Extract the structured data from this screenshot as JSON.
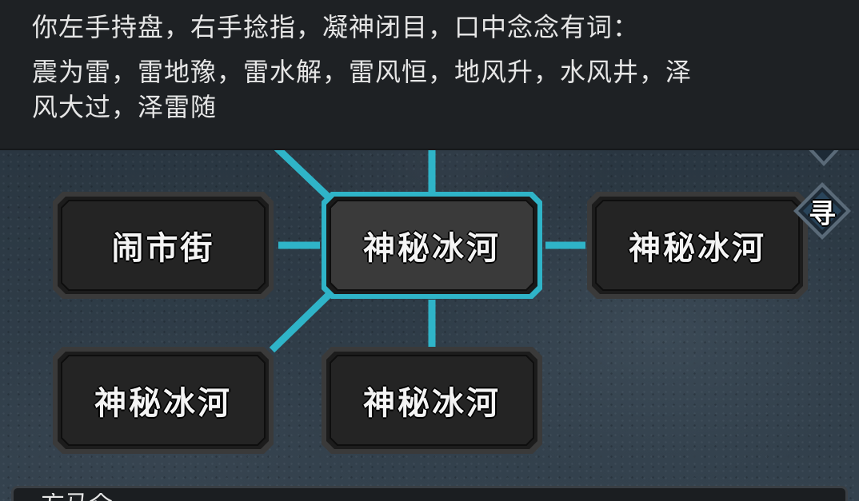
{
  "narration": {
    "lines": [
      "你左手持盘，右手捻指，凝神闭目，口中念念有词：",
      "震为雷，雷地豫，雷水解，雷风恒，地风升，水风井，泽",
      "风大过，泽雷随"
    ]
  },
  "map": {
    "nodes": [
      {
        "id": "market-street",
        "label": "闹市街",
        "current": false
      },
      {
        "id": "current",
        "label": "神秘冰河",
        "current": true
      },
      {
        "id": "east",
        "label": "神秘冰河",
        "current": false
      },
      {
        "id": "southwest",
        "label": "神秘冰河",
        "current": false
      },
      {
        "id": "south",
        "label": "神秘冰河",
        "current": false
      }
    ],
    "search_marker": {
      "label": "寻"
    },
    "bottom_panel_peek": "方马仑"
  },
  "colors": {
    "connector": "#2fb4c8",
    "current_border": "#2fb4c8",
    "node_border": "#3c3c3c",
    "node_fill": "#202020"
  }
}
